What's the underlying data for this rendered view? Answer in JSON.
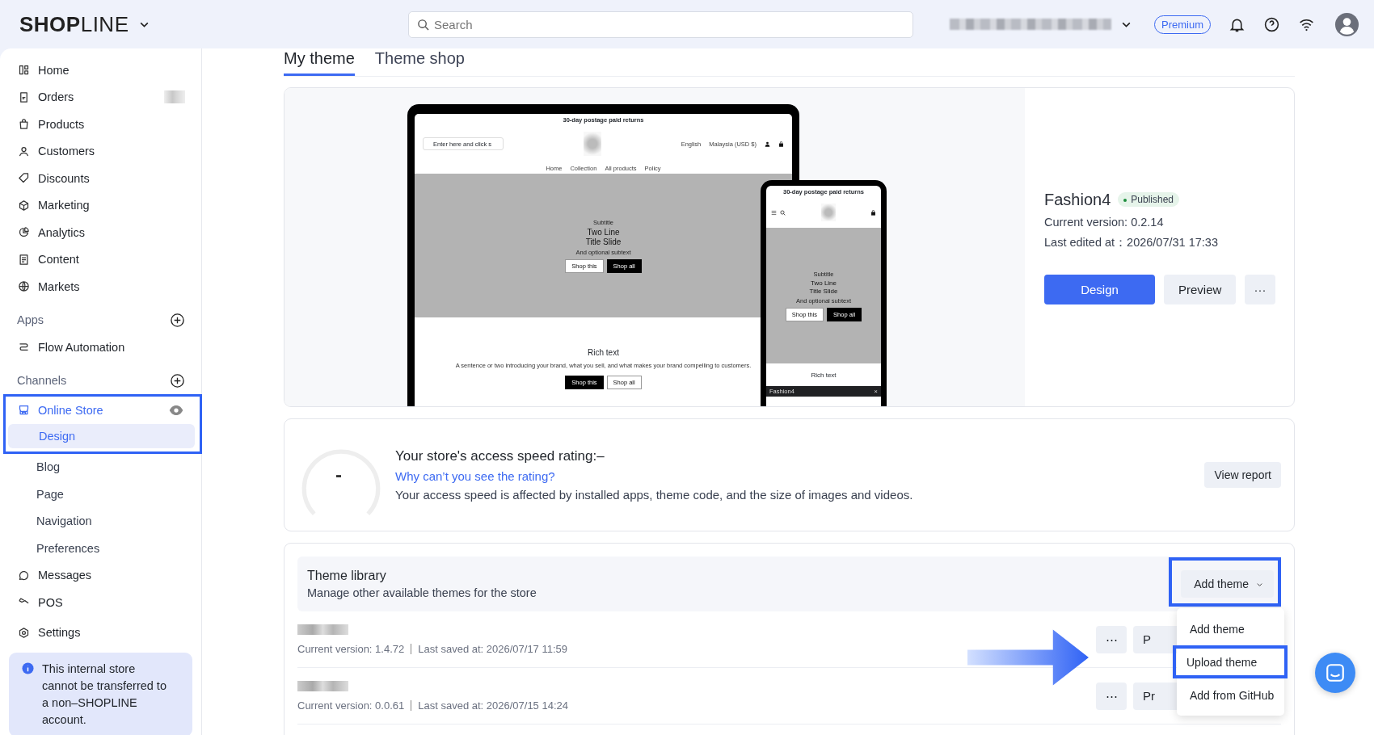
{
  "header": {
    "logo": "**SHOP**LINE",
    "search": {
      "placeholder": "Search"
    },
    "plan_badge": "Premium"
  },
  "sidebar": {
    "items": [
      {
        "label": "Home",
        "selected": false
      },
      {
        "label": "Orders",
        "selected": false,
        "blurred_badge": true
      },
      {
        "label": "Products",
        "selected": false
      },
      {
        "label": "Customers",
        "selected": false
      },
      {
        "label": "Discounts",
        "selected": false
      },
      {
        "label": "Marketing",
        "selected": false
      },
      {
        "label": "Analytics",
        "selected": false
      },
      {
        "label": "Content",
        "selected": false
      },
      {
        "label": "Markets",
        "selected": false
      }
    ],
    "sections": [
      {
        "title": "Apps",
        "items": [
          {
            "label": "Flow Automation",
            "selected": false
          }
        ]
      },
      {
        "title": "Channels",
        "items": [
          {
            "label": "Online Store",
            "selected": false,
            "expanded": true,
            "highlighted": true,
            "has_preview": true,
            "children": [
              {
                "label": "Design",
                "selected": true
              },
              {
                "label": "Blog",
                "selected": false
              },
              {
                "label": "Page",
                "selected": false
              },
              {
                "label": "Navigation",
                "selected": false
              },
              {
                "label": "Preferences",
                "selected": false
              }
            ]
          },
          {
            "label": "Messages",
            "selected": false
          },
          {
            "label": "POS",
            "selected": false
          }
        ]
      }
    ],
    "bottom_items": [
      {
        "label": "Settings",
        "selected": false
      }
    ],
    "notice": "This internal store cannot be transferred to a non–SHOPLINE account."
  },
  "tabs": [
    {
      "label": "My theme",
      "selected": true
    },
    {
      "label": "Theme shop",
      "selected": false
    }
  ],
  "current_theme": {
    "preview": {
      "desktop": {
        "announcement": "30-day postage paid returns",
        "search_placeholder": "Enter here and click s",
        "language": "English",
        "currency": "Malaysia (USD $)",
        "nav": [
          "Home",
          "Collection",
          "All products",
          "Policy"
        ],
        "hero": {
          "subtitle": "Subtitle",
          "title": "Two Line Title Slide",
          "subtext": "And optional subtext",
          "buttons": [
            "Shop this",
            "Shop all"
          ]
        },
        "rich_text": {
          "heading": "Rich text",
          "body": "A sentence or two introducing your brand, what you sell, and what makes your brand compelling to customers.",
          "buttons": [
            "Shop this",
            "Shop all"
          ]
        }
      },
      "mobile": {
        "announcement": "30-day postage paid returns",
        "hero": {
          "subtitle": "Subtitle",
          "title": "Two Line Title Slide",
          "subtext": "And optional subtext",
          "buttons": [
            "Shop this",
            "Shop all"
          ]
        },
        "rich_text": {
          "heading": "Rich text"
        },
        "bottom_bar": {
          "label": "Fashion4",
          "close": "×"
        }
      }
    },
    "name": "Fashion4",
    "status": {
      "label": "Published",
      "kind": "published"
    },
    "version": "Current version: 0.2.14",
    "edited": "Last edited at：2026/07/31 17:33",
    "buttons": [
      {
        "label": "Design",
        "kind": "primary"
      },
      {
        "label": "Preview",
        "kind": "secondary"
      },
      {
        "label": "···",
        "kind": "more"
      }
    ]
  },
  "speed": {
    "rating": "-",
    "title": "Your store's access speed rating:–",
    "link": "Why can’t you see the rating?",
    "description": "Your access speed is affected by installed apps, theme code, and the size of images and videos.",
    "button": "View report"
  },
  "library": {
    "title": "Theme library",
    "subtitle": "Manage other available themes for the store",
    "add_button": {
      "label": "Add theme",
      "highlighted": true
    },
    "rows": [
      {
        "version": "Current version: 1.4.72",
        "saved": "Last saved at: 2026/07/17 11:59",
        "more": "⋯",
        "action": "P"
      },
      {
        "version": "Current version: 0.0.61",
        "saved": "Last saved at: 2026/07/15 14:24",
        "more": "⋯",
        "action": "Pr"
      }
    ],
    "menu": [
      {
        "label": "Add theme",
        "highlighted": false
      },
      {
        "label": "Upload theme",
        "highlighted": true
      },
      {
        "label": "Add from GitHub",
        "highlighted": false
      }
    ]
  }
}
